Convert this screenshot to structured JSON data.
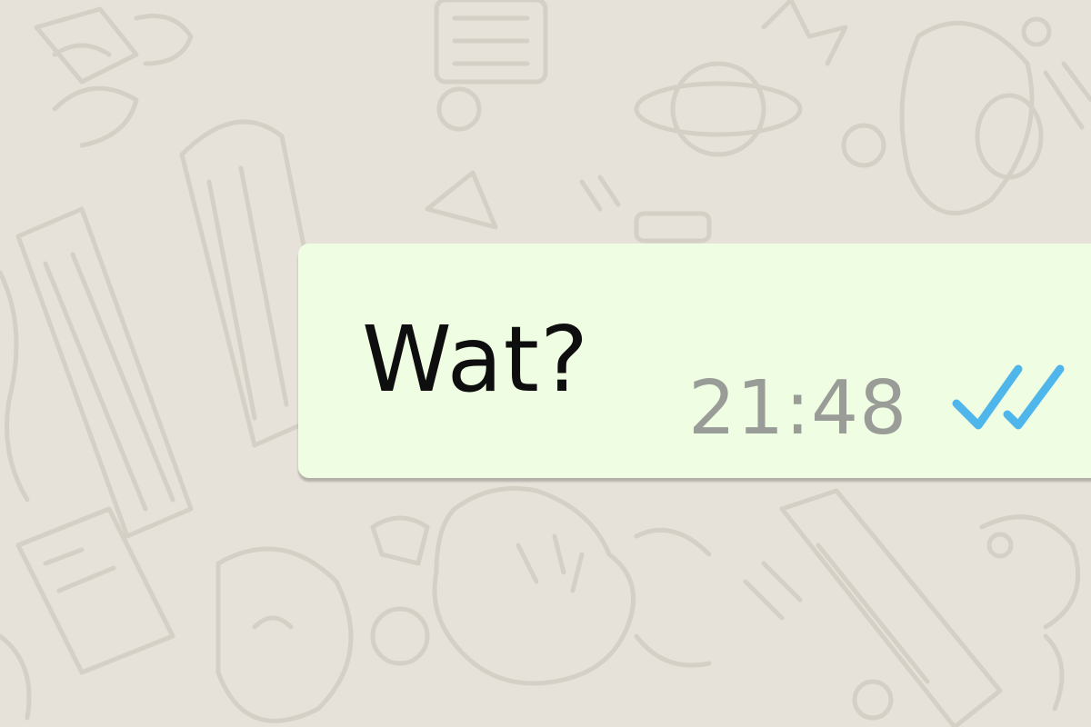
{
  "message": {
    "text": "Wat?",
    "time": "21:48",
    "status_icon": "double-check-icon",
    "status": "read"
  },
  "colors": {
    "chat_background": "#e6e2da",
    "bubble_outgoing": "#effde3",
    "time_text": "#9a9c97",
    "read_ticks": "#4fb6ec"
  }
}
